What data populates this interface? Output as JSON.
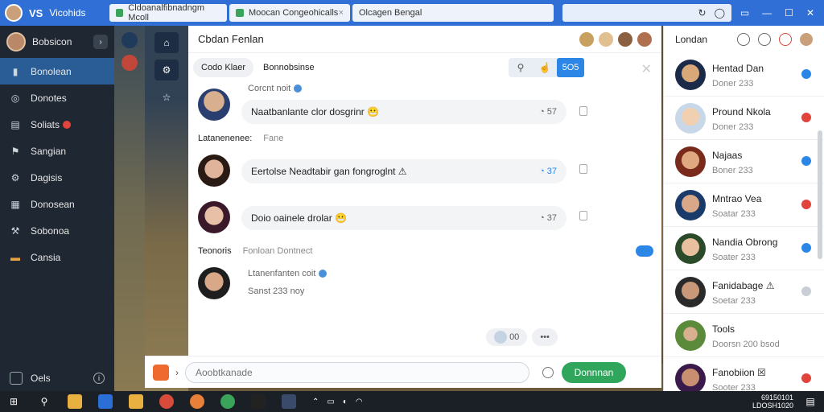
{
  "browser": {
    "brand_logo": "VS",
    "brand_name": "Vicohids",
    "tabs": [
      {
        "label": "Cldoanalfibnadngm Mcoll"
      },
      {
        "label": "Moocan Congeohicalls"
      },
      {
        "label": "Olcagen Bengal"
      }
    ],
    "tab_close": "×",
    "address_icons": [
      "↻",
      "◯"
    ],
    "window_controls": [
      "▭",
      "—",
      "☐",
      "✕"
    ]
  },
  "sidebar": {
    "user_name": "Bobsicon",
    "chevron": "›",
    "items": [
      {
        "label": "Bonolean",
        "icon": "▮",
        "icon_name": "phone-icon"
      },
      {
        "label": "Donotes",
        "icon": "◎",
        "icon_name": "disc-icon"
      },
      {
        "label": "Soliats",
        "icon": "▤",
        "icon_name": "chat-icon"
      },
      {
        "label": "Sangian",
        "icon": "⚑",
        "icon_name": "flag-icon"
      },
      {
        "label": "Dagisis",
        "icon": "⚙",
        "icon_name": "gear-icon"
      },
      {
        "label": "Donosean",
        "icon": "▦",
        "icon_name": "grid-icon"
      },
      {
        "label": "Sobonoa",
        "icon": "⚒",
        "icon_name": "tools-icon"
      },
      {
        "label": "Cansia",
        "icon": "▬",
        "icon_name": "folder-icon"
      }
    ],
    "footer_label": "Oels",
    "footer_info": "i"
  },
  "chat": {
    "title": "Cbdan Fenlan",
    "filter_pill": "Codo Klaer",
    "filter_text": "Bonnobsinse",
    "tool_primary": "5O5",
    "close": "✕",
    "messages": [
      {
        "meta": "Corcnt noit",
        "text": "Naatbanlante clor dosgrinr 😬",
        "count": "◔ 57",
        "blue": false
      },
      {
        "meta": "",
        "text": "Eertolse Neadtabir gan fongroglnt ⚠",
        "count": "◔ 37",
        "blue": true
      },
      {
        "meta": "",
        "text": "Doio oainele drolar 😬",
        "count": "◔ 37",
        "blue": false
      }
    ],
    "section1_label": "Latanenenee:",
    "section1_sub": "Fane",
    "section2_label": "Teonoris",
    "section2_sub": "Fonloan Dontnect",
    "reply_meta": "Ltanenfanten coit",
    "reply_meta2": "Sanst 233 noy",
    "react_count": "00",
    "react_dots": "•••"
  },
  "composer": {
    "placeholder": "Aoobtkanade",
    "send_label": "Donnnan"
  },
  "rpanel": {
    "title": "Londan",
    "contacts": [
      {
        "name": "Hentad Dan",
        "status": "Doner 233",
        "color": "#2b86e6"
      },
      {
        "name": "Pround Nkola",
        "status": "Doner 233",
        "color": "#e0443a"
      },
      {
        "name": "Najaas",
        "status": "Boner 233",
        "color": "#2b86e6"
      },
      {
        "name": "Mntrao Vea",
        "status": "Soatar 233",
        "color": "#e0443a"
      },
      {
        "name": "Nandia Obrong",
        "status": "Soater 233",
        "color": "#2b86e6"
      },
      {
        "name": "Fanidabage ⚠",
        "status": "Soetar 233",
        "color": "#c9ced6"
      },
      {
        "name": "Tools",
        "status": "Doorsn 200 bsod",
        "color": "#ffffff"
      },
      {
        "name": "Fanobiion ☒",
        "status": "Sooter 233",
        "color": "#e0443a"
      }
    ]
  },
  "taskbar": {
    "clock_line1": "69150101",
    "clock_line2": "LDOSH1020"
  }
}
